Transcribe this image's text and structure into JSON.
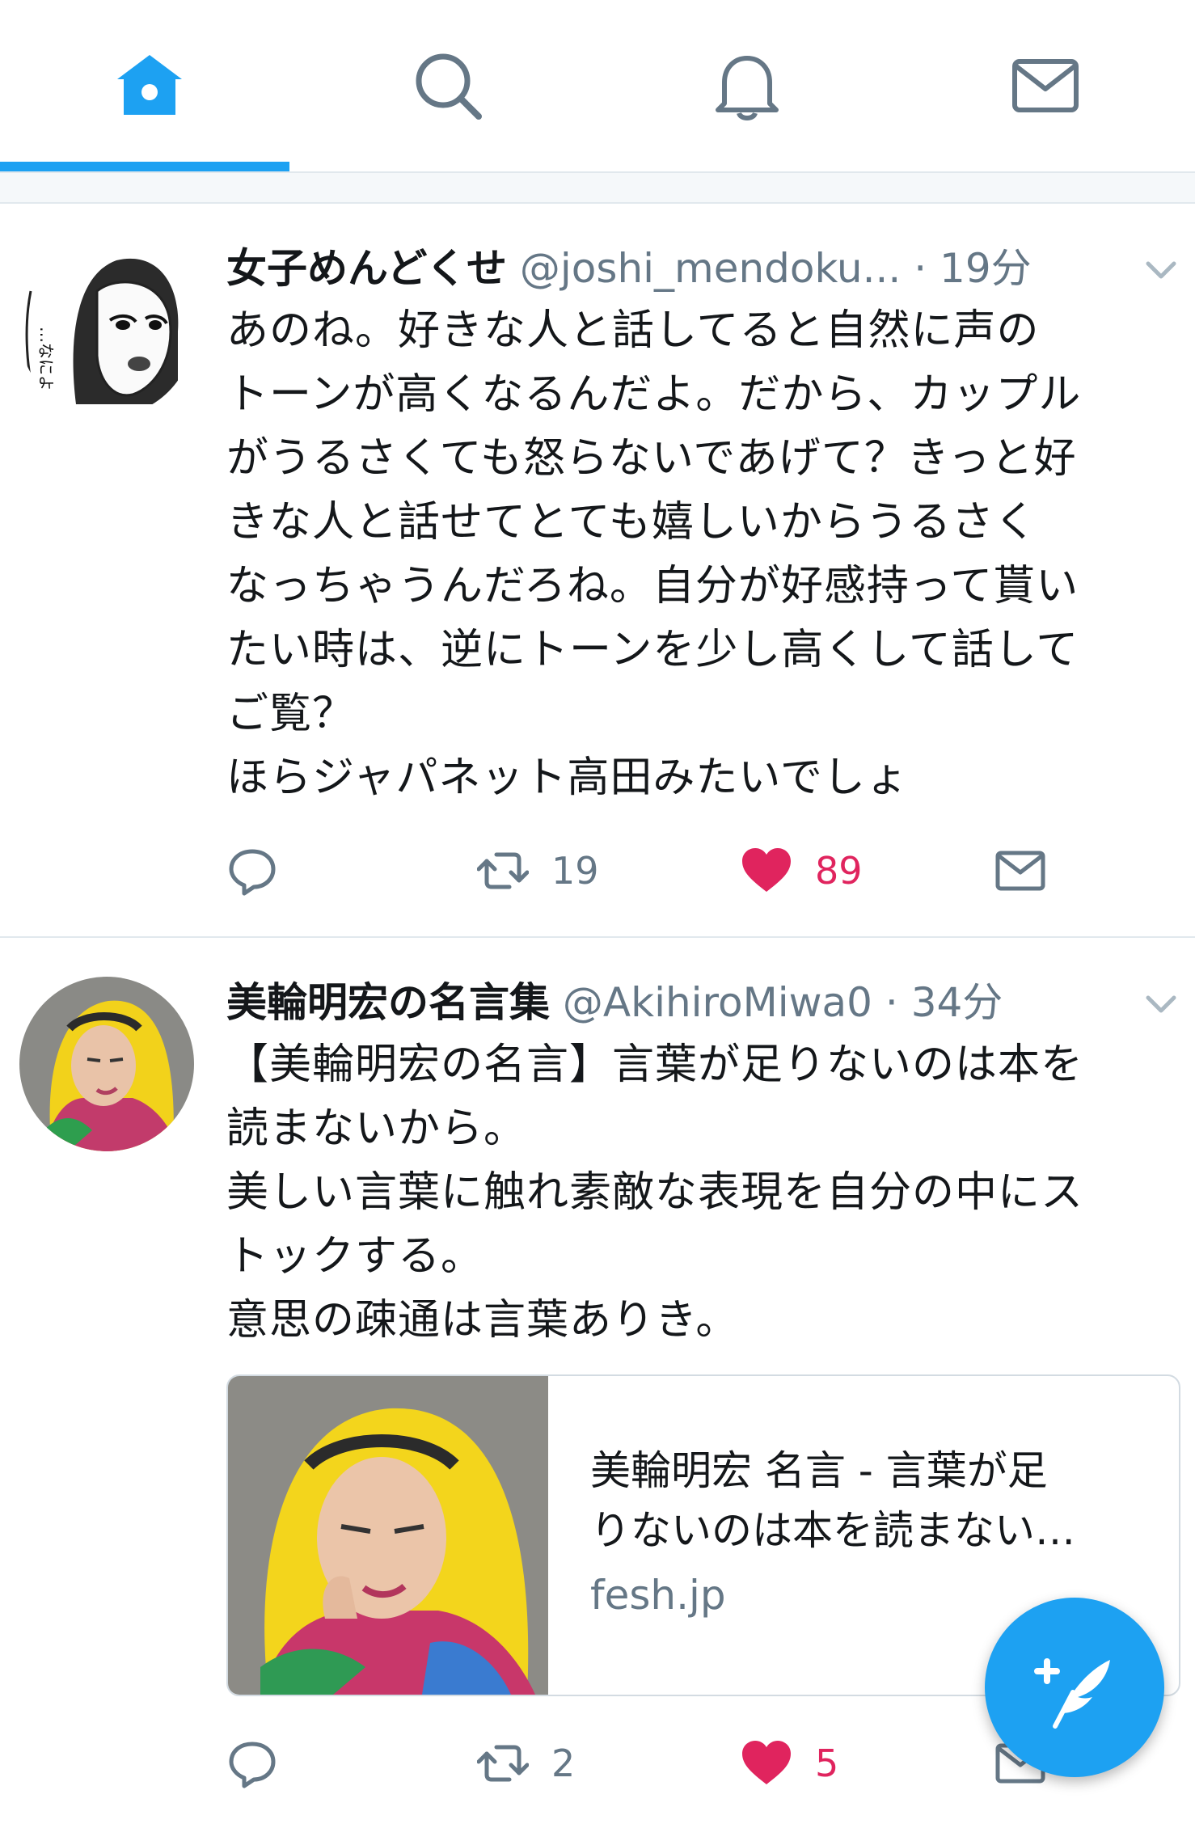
{
  "nav": {
    "tabs": [
      {
        "name": "home",
        "icon": "home-icon",
        "active": true
      },
      {
        "name": "search",
        "icon": "search-icon",
        "active": false
      },
      {
        "name": "notifications",
        "icon": "bell-icon",
        "active": false
      },
      {
        "name": "messages",
        "icon": "envelope-icon",
        "active": false
      }
    ],
    "active_color": "#1da1f2",
    "inactive_color": "#657786"
  },
  "tweets": [
    {
      "display_name": "女子めんどくせ",
      "handle": "@joshi_mendoku...",
      "separator": "·",
      "time": "19分",
      "text": "あのね。好きな人と話してると自然に声の\nトーンが高くなるんだよ。だから、カップル\nがうるさくても怒らないであげて？きっと好\nきな人と話せてとても嬉しいからうるさく\nなっちゃうんだろね。自分が好感持って貰い\nたい時は、逆にトーンを少し高くして話して\nご覧？\nほらジャパネット高田みたいでしょ",
      "avatar_icon": "manga-woman-avatar",
      "actions": {
        "reply_count": "",
        "retweet_count": "19",
        "like_count": "89",
        "liked": true
      }
    },
    {
      "display_name": "美輪明宏の名言集",
      "handle": "@AkihiroMiwa0",
      "separator": "·",
      "time": "34分",
      "text": "【美輪明宏の名言】言葉が足りないのは本を\n読まないから。\n美しい言葉に触れ素敵な表現を自分の中にス\nトックする。\n意思の疎通は言葉ありき。",
      "avatar_icon": "yellow-hair-portrait-avatar",
      "card": {
        "title": "美輪明宏 名言 - 言葉が足\nりないのは本を読まない…",
        "domain": "fesh.jp"
      },
      "actions": {
        "reply_count": "",
        "retweet_count": "2",
        "like_count": "5",
        "liked": true
      }
    }
  ],
  "colors": {
    "accent": "#1da1f2",
    "like": "#e0245e",
    "secondary_text": "#657786",
    "primary_text": "#14171a"
  },
  "fab": {
    "icon": "compose-tweet-icon"
  }
}
